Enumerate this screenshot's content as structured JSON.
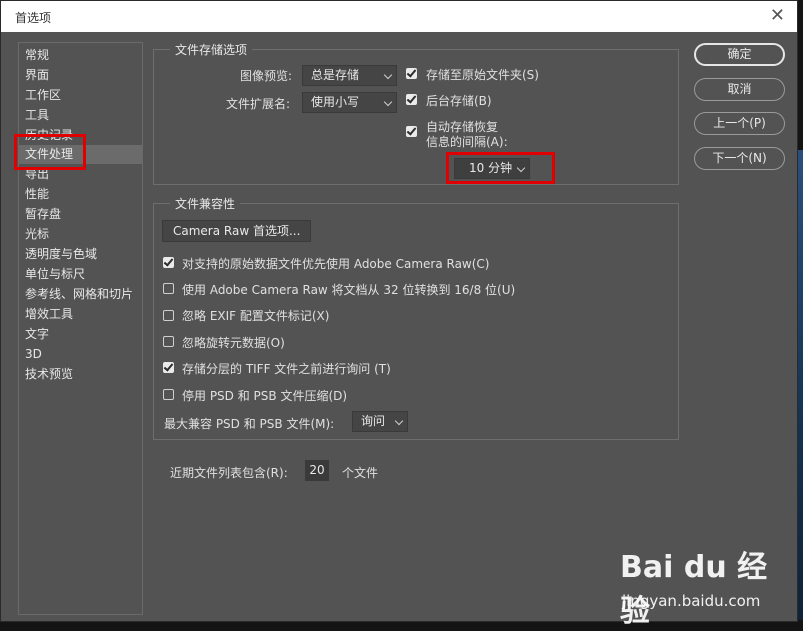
{
  "window": {
    "title": "首选项"
  },
  "sidebar": {
    "items": [
      {
        "label": "常规"
      },
      {
        "label": "界面"
      },
      {
        "label": "工作区"
      },
      {
        "label": "工具"
      },
      {
        "label": "历史记录"
      },
      {
        "label": "文件处理"
      },
      {
        "label": "导出"
      },
      {
        "label": "性能"
      },
      {
        "label": "暂存盘"
      },
      {
        "label": "光标"
      },
      {
        "label": "透明度与色域"
      },
      {
        "label": "单位与标尺"
      },
      {
        "label": "参考线、网格和切片"
      },
      {
        "label": "增效工具"
      },
      {
        "label": "文字"
      },
      {
        "label": "3D"
      },
      {
        "label": "技术预览"
      }
    ],
    "selected": "文件处理"
  },
  "file_saving": {
    "group_title": "文件存储选项",
    "image_preview_label": "图像预览:",
    "image_preview_value": "总是存储",
    "extension_label": "文件扩展名:",
    "extension_value": "使用小写",
    "save_to_original": {
      "label": "存储至原始文件夹(S)",
      "checked": true
    },
    "background_save": {
      "label": "后台存储(B)",
      "checked": true
    },
    "auto_save": {
      "label_line1": "自动存储恢复",
      "label_line2": "信息的间隔(A):",
      "checked": true
    },
    "interval_value": "10 分钟"
  },
  "compatibility": {
    "group_title": "文件兼容性",
    "camera_raw_button": "Camera Raw 首选项...",
    "options": [
      {
        "label": "对支持的原始数据文件优先使用 Adobe Camera Raw(C)",
        "checked": true
      },
      {
        "label": "使用 Adobe Camera Raw 将文档从 32 位转换到 16/8 位(U)",
        "checked": false
      },
      {
        "label": "忽略 EXIF 配置文件标记(X)",
        "checked": false
      },
      {
        "label": "忽略旋转元数据(O)",
        "checked": false
      },
      {
        "label": "存储分层的 TIFF 文件之前进行询问 (T)",
        "checked": true
      },
      {
        "label": "停用 PSD 和 PSB 文件压缩(D)",
        "checked": false
      }
    ],
    "max_compat_label": "最大兼容 PSD 和 PSB 文件(M):",
    "max_compat_value": "询问"
  },
  "recent_files": {
    "label": "近期文件列表包含(R):",
    "value": "20",
    "suffix": "个文件"
  },
  "buttons": {
    "ok": "确定",
    "cancel": "取消",
    "prev": "上一个(P)",
    "next": "下一个(N)"
  },
  "watermark": {
    "logo": "Bai du 经验",
    "url": "jingyan.baidu.com"
  },
  "colors": {
    "dialog_bg": "#535353",
    "highlight_box": "#e00000",
    "titlebar_bg": "#ffffff"
  }
}
